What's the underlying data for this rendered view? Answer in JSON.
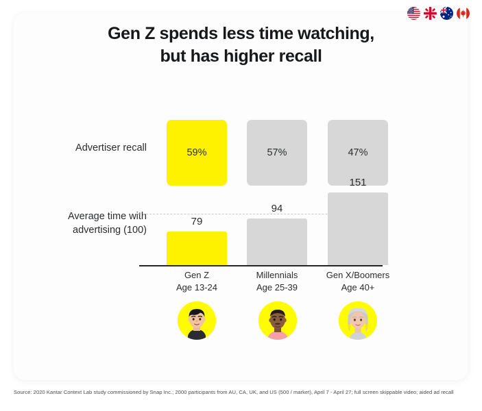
{
  "title": {
    "line1": "Gen Z spends less time watching,",
    "line2": "but has higher recall"
  },
  "flags": [
    {
      "name": "flag-us",
      "label": "United States"
    },
    {
      "name": "flag-uk",
      "label": "United Kingdom"
    },
    {
      "name": "flag-au",
      "label": "Australia"
    },
    {
      "name": "flag-ca",
      "label": "Canada"
    }
  ],
  "avatars": [
    {
      "name": "avatar-gen-z",
      "label": "Gen Z avatar"
    },
    {
      "name": "avatar-millennials",
      "label": "Millennials avatar"
    },
    {
      "name": "avatar-gen-x-boomers",
      "label": "Gen X/Boomers avatar"
    }
  ],
  "footnote": "Source: 2020 Kantar Context Lab study commissioned by Snap Inc.; 2000 participants from AU, CA, UK, and US (500 / market), April 7 - April 27; full screen skippable video; aided ad recall",
  "colors": {
    "highlight": "#FFF200",
    "neutral": "#D7D7D7",
    "snap_yellow": "#FFFC00",
    "text": "#2a2c2e",
    "axis": "#232527",
    "dotted": "#c9c9c9"
  },
  "chart_data": {
    "type": "bar",
    "title": "Gen Z spends less time watching, but has higher recall",
    "xlabel": "",
    "ylabel": "",
    "grid": false,
    "legend": "none",
    "categories": [
      "Gen Z",
      "Millennials",
      "Gen X/Boomers"
    ],
    "category_sublabels": [
      "Age 13-24",
      "Age 25-39",
      "Age 40+"
    ],
    "series": [
      {
        "name": "Advertiser recall",
        "unit": "%",
        "values": [
          59,
          57,
          47
        ],
        "value_labels": [
          "59%",
          "57%",
          "47%"
        ],
        "bar_colors": [
          "#FFF200",
          "#D7D7D7",
          "#D7D7D7"
        ],
        "note": "displayed as equal-size rounded squares with value inside"
      },
      {
        "name": "Average time with advertising (100)",
        "unit": "index",
        "values": [
          79,
          94,
          151
        ],
        "value_labels": [
          "79",
          "94",
          "151"
        ],
        "bar_colors": [
          "#FFF200",
          "#D7D7D7",
          "#D7D7D7"
        ],
        "reference_line": 100,
        "reference_line_style": "dotted",
        "ylim": [
          0,
          170
        ]
      }
    ]
  }
}
